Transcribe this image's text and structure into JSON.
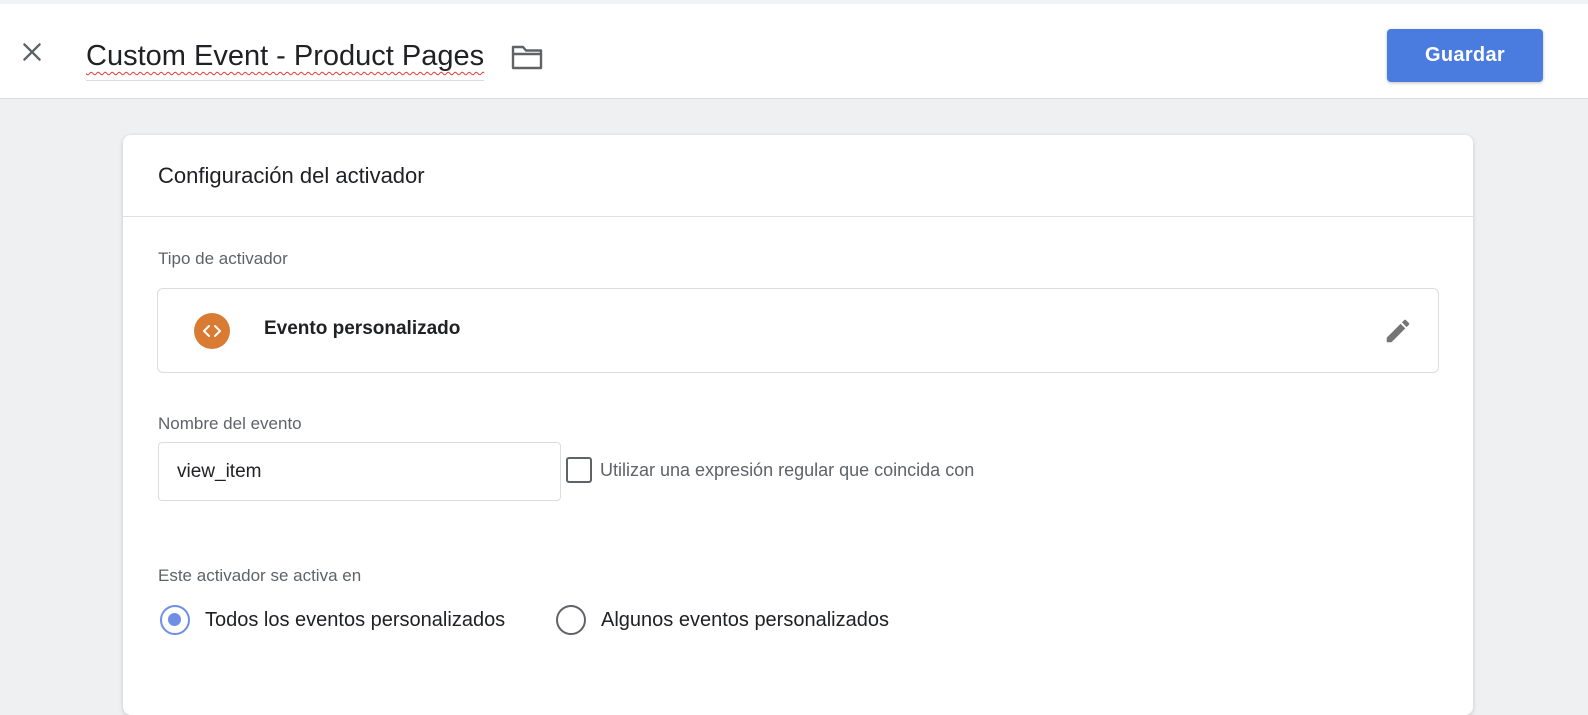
{
  "header": {
    "title": "Custom Event - Product Pages",
    "close_icon": "close-icon",
    "folder_icon": "folder-icon",
    "save_label": "Guardar",
    "save_color": "#4a7bdf"
  },
  "card": {
    "title": "Configuración del activador",
    "trigger_type": {
      "label": "Tipo de activador",
      "name": "Evento personalizado",
      "icon": "custom-event-code-icon",
      "icon_color": "#d97b33",
      "edit_icon": "pencil-icon"
    },
    "event_name": {
      "label": "Nombre del evento",
      "value": "view_item",
      "regex_label": "Utilizar una expresión regular que coincida con",
      "regex_checked": false
    },
    "fires_on": {
      "label": "Este activador se activa en",
      "options": [
        {
          "label": "Todos los eventos personalizados",
          "selected": true
        },
        {
          "label": "Algunos eventos personalizados",
          "selected": false
        }
      ]
    }
  }
}
